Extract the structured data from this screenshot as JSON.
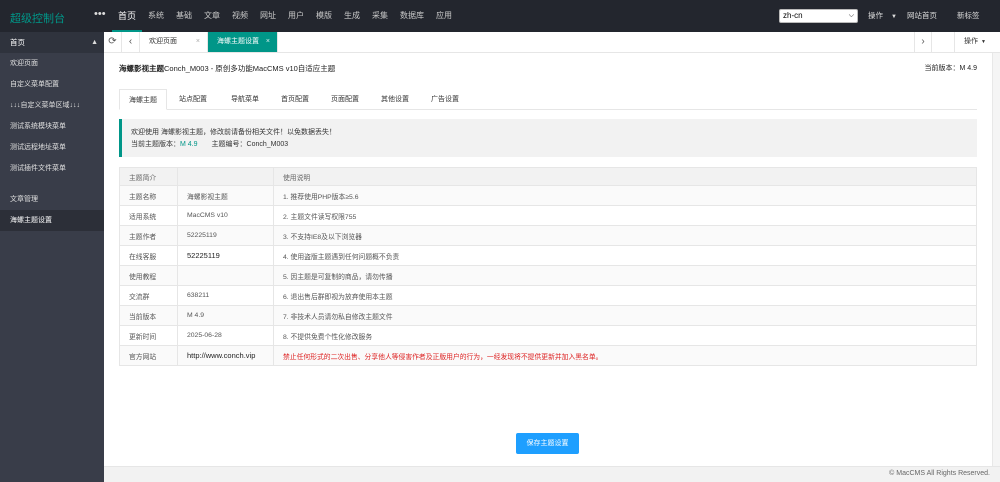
{
  "topbar": {
    "brand": "超级控制台",
    "more": "•••",
    "nav": [
      "首页",
      "系统",
      "基础",
      "文章",
      "视频",
      "网址",
      "用户",
      "模版",
      "生成",
      "采集",
      "数据库",
      "应用"
    ],
    "lang": "zh-cn",
    "ops": "操作",
    "site_home": "网站首页",
    "new_tab": "新标签"
  },
  "sidebar": {
    "head": "首页",
    "items": [
      "欢迎页面",
      "自定义菜单配置",
      "↓↓↓自定义菜单区域↓↓↓",
      "测试系统模块菜单",
      "测试远程地址菜单",
      "测试插件文件菜单"
    ],
    "group": "文章管理",
    "active": "海螺主题设置"
  },
  "tabs": {
    "welcome": "欢迎页面",
    "current": "海螺主题设置",
    "close": "×",
    "ops": "操作"
  },
  "page": {
    "title_bold": "海螺影视主题",
    "title_rest": "Conch_M003 - 原创多功能MacCMS v10自适应主题",
    "version_label": "当前版本：",
    "version": "M 4.9"
  },
  "inner_tabs": [
    "海螺主题",
    "站点配置",
    "导航菜单",
    "首页配置",
    "页面配置",
    "其他设置",
    "广告设置"
  ],
  "notice": {
    "line1": "欢迎使用 海螺影视主题，修改前请备份相关文件！以免数据丢失！",
    "ver_label": "当前主题版本：",
    "ver": "M 4.9",
    "code_label": "主题编号：",
    "code": "Conch_M003"
  },
  "table": {
    "headers": [
      "主题简介",
      "",
      "使用说明"
    ],
    "rows": [
      {
        "k": "主题名称",
        "v": "海螺影视主题",
        "note": "1. 推荐使用PHP版本≥5.6"
      },
      {
        "k": "适用系统",
        "v": "MacCMS v10",
        "note": "2. 主题文件读写权限755"
      },
      {
        "k": "主题作者",
        "v": "52225119",
        "note": "3. 不支持IE8及以下浏览器"
      },
      {
        "k": "在线客服",
        "v": "52225119",
        "note": "4. 使用盗版主题遇到任何问题概不负责"
      },
      {
        "k": "使用教程",
        "v": "",
        "note": "5. 因主题是可复制的商品，请勿传播"
      },
      {
        "k": "交流群",
        "v": "638211",
        "note": "6. 退出售后群即视为放弃使用本主题"
      },
      {
        "k": "当前版本",
        "v": "M 4.9",
        "note": "7. 非技术人员请勿私自修改主题文件"
      },
      {
        "k": "更新时间",
        "v": "2025-06-28",
        "note": "8. 不提供免费个性化修改服务"
      },
      {
        "k": "官方网站",
        "v": "http://www.conch.vip",
        "note": "禁止任何形式的二次出售、分享他人等侵害作者及正版用户的行为，一经发现将不提供更新并加入黑名单。"
      }
    ]
  },
  "save_button": "保存主题设置",
  "footer": "© MacCMS All Rights Reserved.",
  "colors": {
    "accent": "#009688",
    "button": "#1e9fff",
    "warning": "#dd2222"
  }
}
